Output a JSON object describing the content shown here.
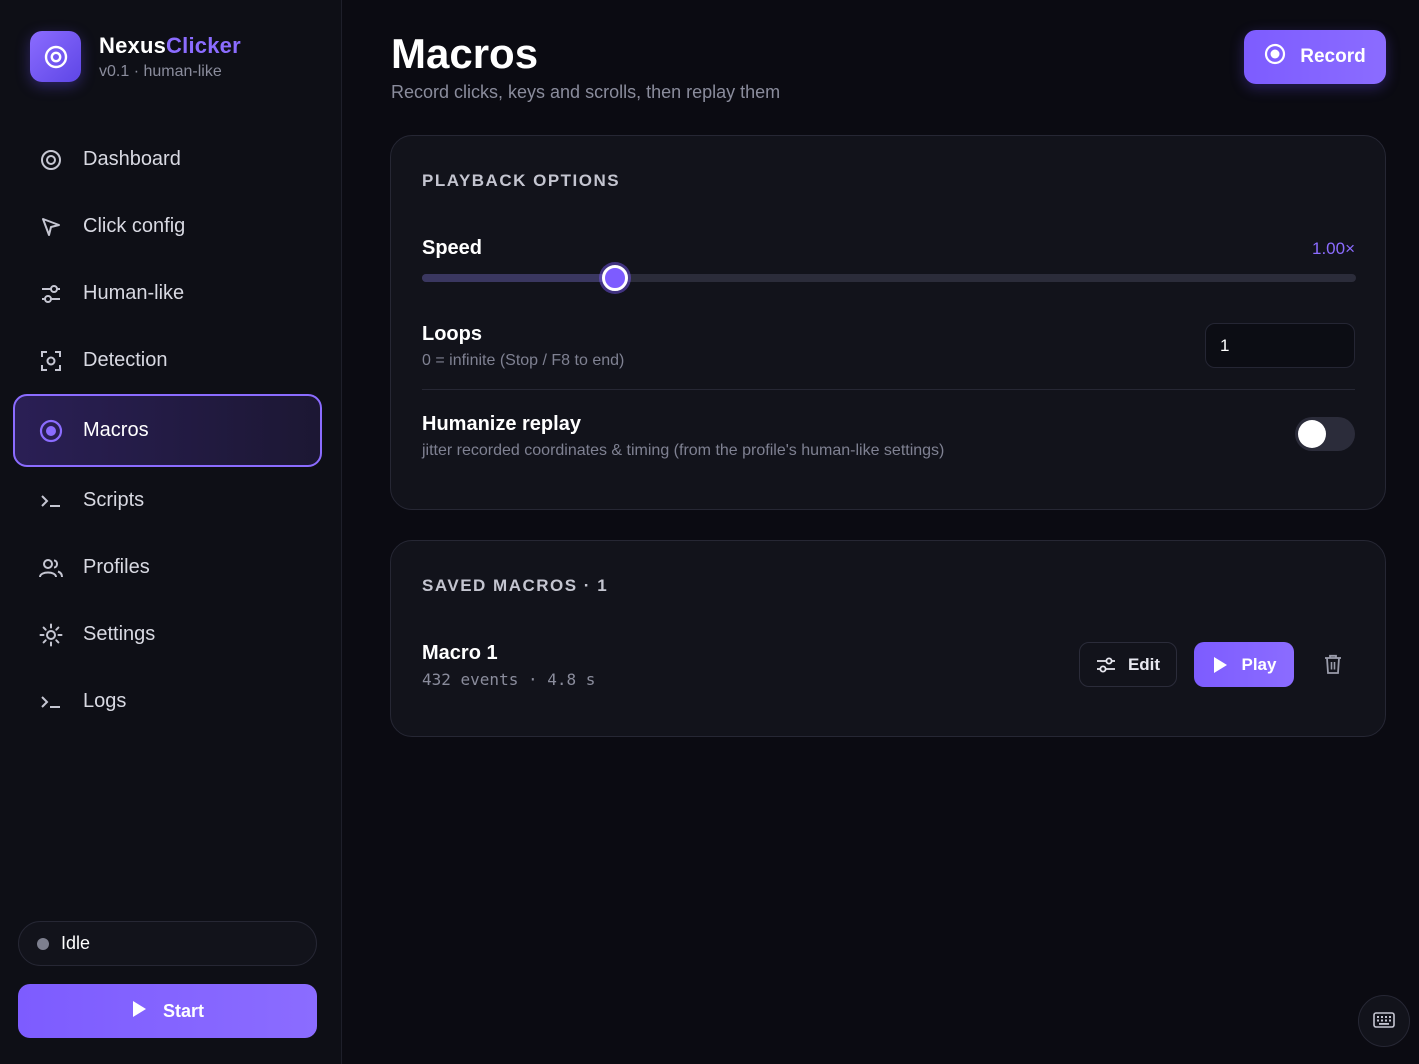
{
  "brand": {
    "name_main": "Nexus",
    "name_accent": "Clicker",
    "subtitle": "v0.1 · human-like"
  },
  "nav": {
    "items": [
      {
        "label": "Dashboard",
        "icon": "dashboard-icon"
      },
      {
        "label": "Click config",
        "icon": "cursor-icon"
      },
      {
        "label": "Human-like",
        "icon": "sliders-icon"
      },
      {
        "label": "Detection",
        "icon": "scan-icon"
      },
      {
        "label": "Macros",
        "icon": "record-icon",
        "active": true
      },
      {
        "label": "Scripts",
        "icon": "terminal-icon"
      },
      {
        "label": "Profiles",
        "icon": "users-icon"
      },
      {
        "label": "Settings",
        "icon": "sun-gear-icon"
      },
      {
        "label": "Logs",
        "icon": "terminal-icon"
      }
    ]
  },
  "status": {
    "label": "Idle",
    "color": "#7d7f8e"
  },
  "start_button": {
    "label": "Start"
  },
  "page": {
    "title": "Macros",
    "subtitle": "Record clicks, keys and scrolls, then replay them"
  },
  "record_button": {
    "label": "Record"
  },
  "playback": {
    "section_title": "PLAYBACK OPTIONS",
    "speed": {
      "label": "Speed",
      "value_text": "1.00×",
      "fraction": 0.207
    },
    "loops": {
      "label": "Loops",
      "help": "0 = infinite (Stop / F8 to end)",
      "value": "1"
    },
    "humanize": {
      "label": "Humanize replay",
      "help": "jitter recorded coordinates & timing (from the profile's human-like settings)",
      "enabled": false
    }
  },
  "saved": {
    "section_title": "SAVED MACROS · 1",
    "macros": [
      {
        "name": "Macro 1",
        "meta": "432 events · 4.8 s",
        "edit_label": "Edit",
        "play_label": "Play"
      }
    ]
  },
  "colors": {
    "accent": "#8b6cff",
    "background": "#0b0b12",
    "card": "#12131b"
  }
}
